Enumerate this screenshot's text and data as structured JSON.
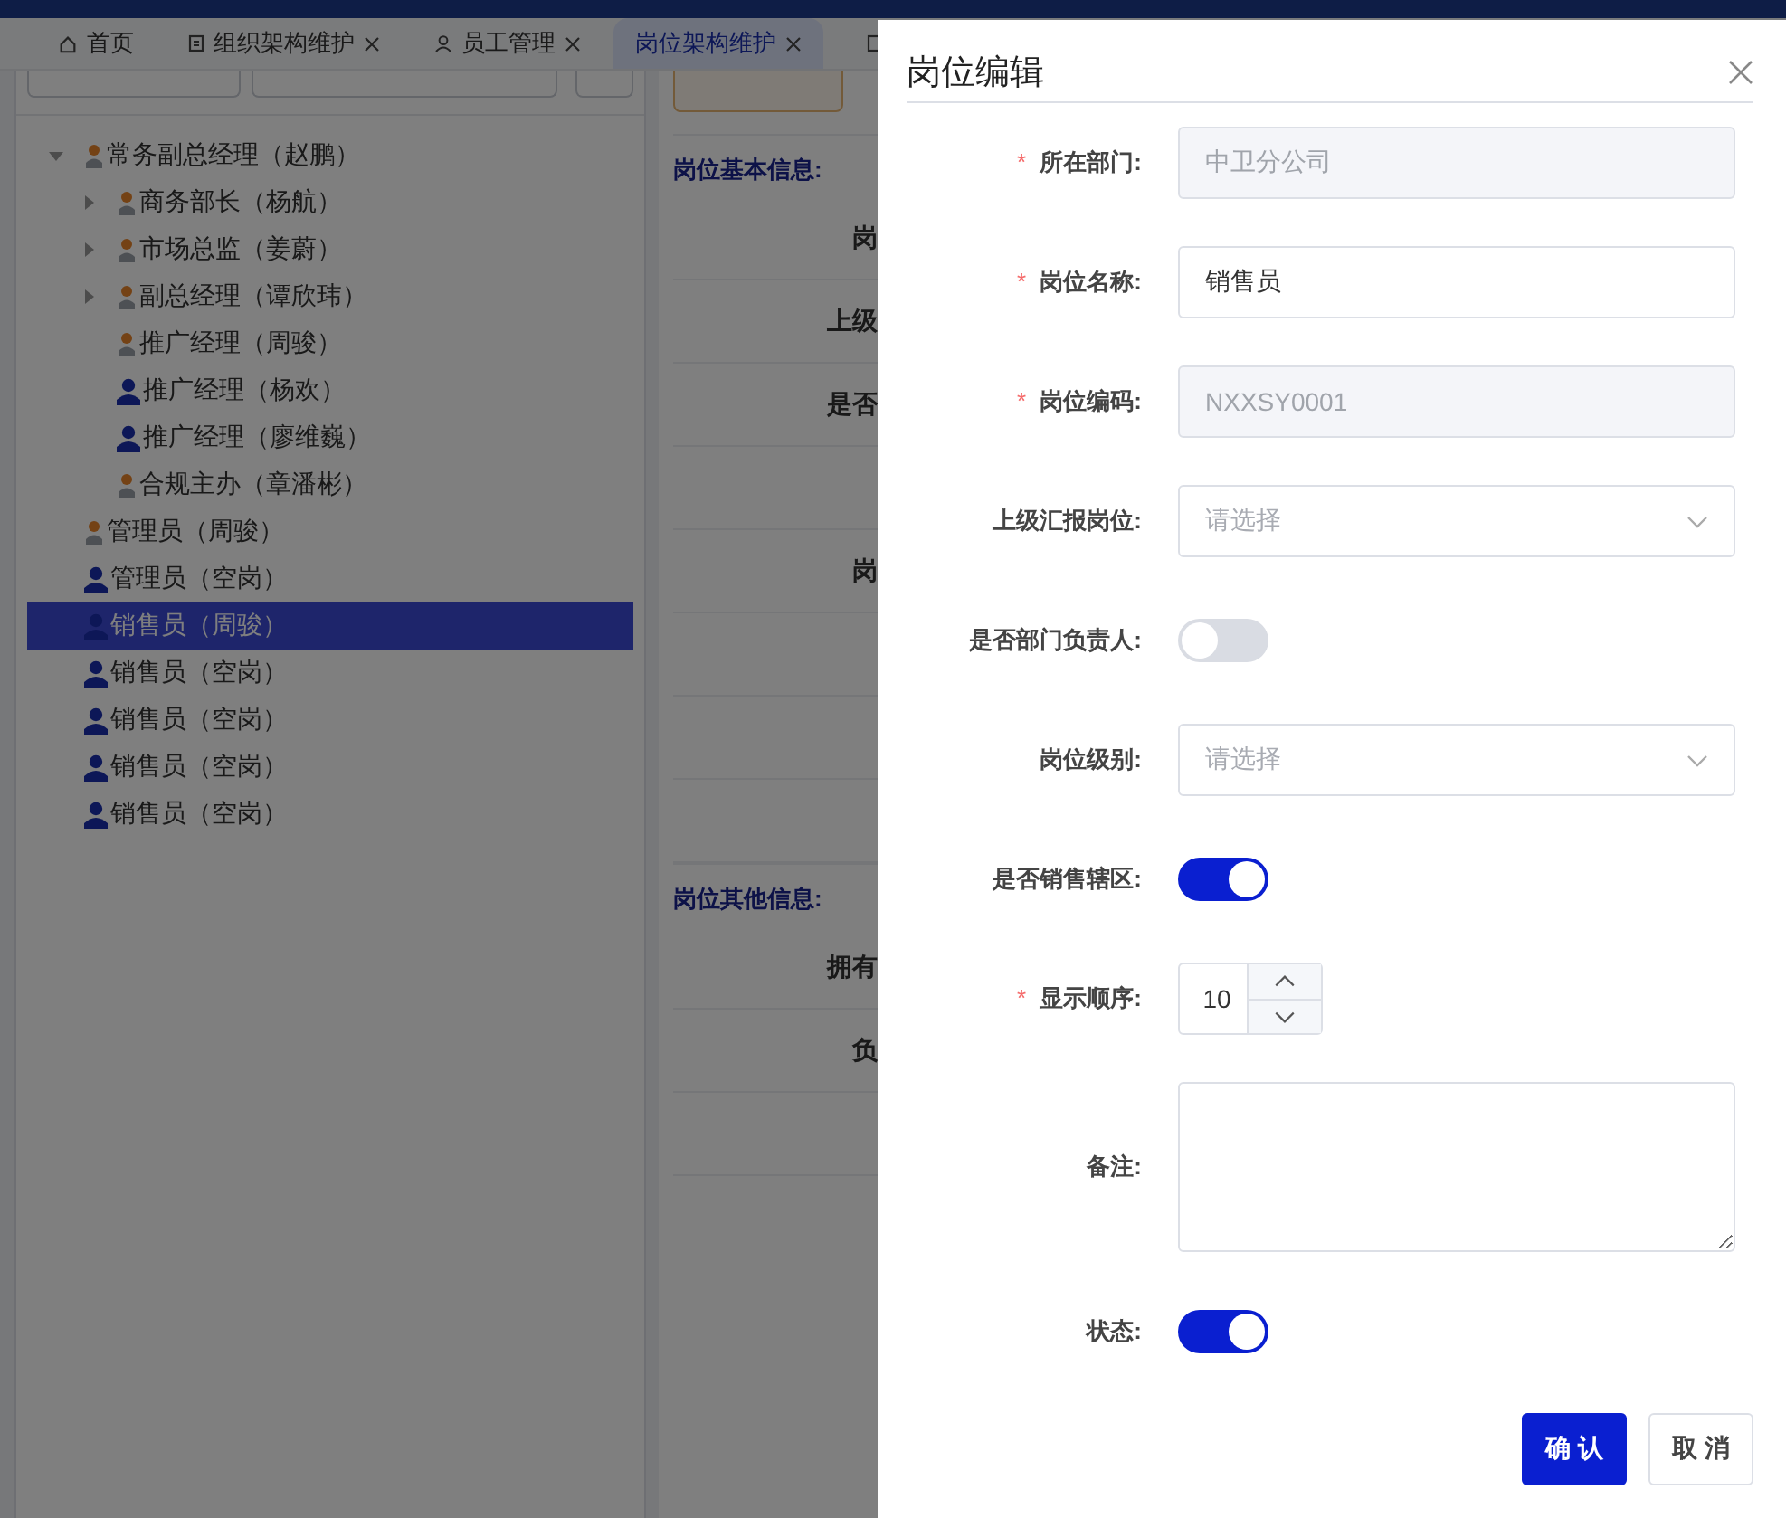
{
  "tabs": [
    {
      "label": "首页",
      "closable": false,
      "selected": false
    },
    {
      "label": "组织架构维护",
      "closable": true,
      "selected": false
    },
    {
      "label": "员工管理",
      "closable": true,
      "selected": false
    },
    {
      "label": "岗位架构维护",
      "closable": true,
      "selected": true
    }
  ],
  "tree": [
    {
      "label": "常务副总经理（赵鹏）",
      "kind": "occupied",
      "expanded": true,
      "selected": false,
      "children": [
        {
          "label": "商务部长（杨航）",
          "kind": "occupied",
          "expanded": false,
          "selected": false,
          "has_children": true
        },
        {
          "label": "市场总监（姜蔚）",
          "kind": "occupied",
          "expanded": false,
          "selected": false,
          "has_children": true
        },
        {
          "label": "副总经理（谭欣玮）",
          "kind": "occupied",
          "expanded": false,
          "selected": false,
          "has_children": true
        },
        {
          "label": "推广经理（周骏）",
          "kind": "occupied",
          "selected": false
        },
        {
          "label": "推广经理（杨欢）",
          "kind": "vacant",
          "selected": false
        },
        {
          "label": "推广经理（廖维巍）",
          "kind": "vacant",
          "selected": false
        },
        {
          "label": "合规主办（章潘彬）",
          "kind": "occupied",
          "selected": false
        }
      ]
    },
    {
      "label": "管理员（周骏）",
      "kind": "occupied",
      "selected": false
    },
    {
      "label": "管理员（空岗）",
      "kind": "vacant",
      "selected": false
    },
    {
      "label": "销售员（周骏）",
      "kind": "vacant",
      "selected": true
    },
    {
      "label": "销售员（空岗）",
      "kind": "vacant",
      "selected": false
    },
    {
      "label": "销售员（空岗）",
      "kind": "vacant",
      "selected": false
    },
    {
      "label": "销售员（空岗）",
      "kind": "vacant",
      "selected": false
    },
    {
      "label": "销售员（空岗）",
      "kind": "vacant",
      "selected": false
    }
  ],
  "detail": [
    {
      "title": "岗位基本信息:",
      "rows": [
        {
          "label": "岗"
        },
        {
          "label": "上级"
        },
        {
          "label": "是否"
        },
        {},
        {
          "label": "岗"
        },
        {},
        {},
        {}
      ]
    },
    {
      "title": "岗位其他信息:",
      "rows": [
        {
          "label": "拥有"
        },
        {
          "label": "负"
        },
        {}
      ]
    }
  ],
  "dialog": {
    "title": "岗位编辑",
    "fields": [
      {
        "label": "所在部门:",
        "required_mark": "*",
        "kind": "input",
        "disabled": true,
        "value": "中卫分公司"
      },
      {
        "label": "岗位名称:",
        "required_mark": "*",
        "kind": "input",
        "disabled": false,
        "value": "销售员"
      },
      {
        "label": "岗位编码:",
        "required_mark": "*",
        "kind": "input",
        "disabled": true,
        "value": "NXXSY0001"
      },
      {
        "label": "上级汇报岗位:",
        "kind": "select",
        "placeholder": "请选择"
      },
      {
        "label": "是否部门负责人:",
        "kind": "switch",
        "on": false
      },
      {
        "label": "岗位级别:",
        "kind": "select",
        "placeholder": "请选择"
      },
      {
        "label": "是否销售辖区:",
        "kind": "switch",
        "on": true
      },
      {
        "label": "显示顺序:",
        "required_mark": "*",
        "kind": "number",
        "value": "10"
      },
      {
        "label": "备注:",
        "kind": "textarea"
      },
      {
        "label": "状态:",
        "kind": "switch",
        "on": true
      }
    ],
    "buttons": [
      {
        "label": "确 认",
        "kind": "primary"
      },
      {
        "label": "取 消",
        "kind": "default"
      }
    ]
  }
}
